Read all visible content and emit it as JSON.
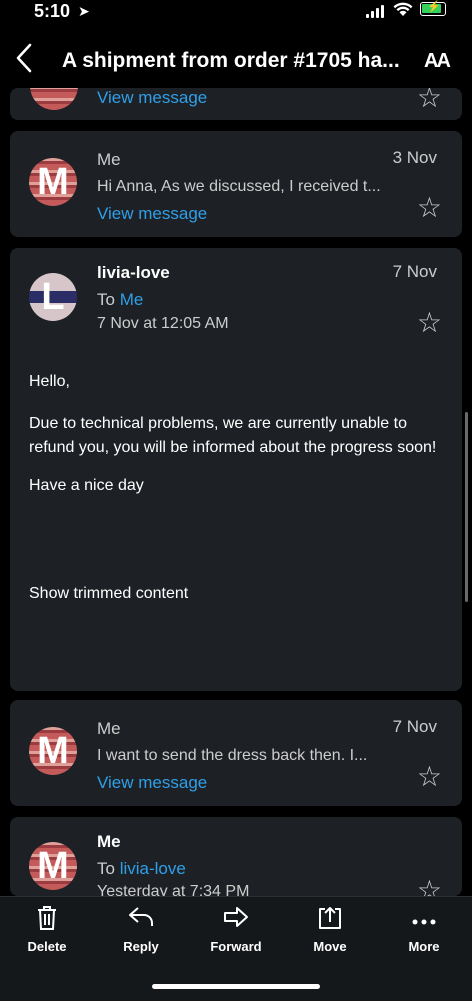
{
  "status": {
    "time": "5:10"
  },
  "nav": {
    "title": "A shipment from order #1705 ha...",
    "text_size_icon": "AA"
  },
  "top_card": {
    "link": "View message"
  },
  "message2": {
    "sender": "Me",
    "date": "3 Nov",
    "preview": "Hi Anna, As we discussed, I received t...",
    "link": "View message",
    "avatar_letter": "M"
  },
  "message3": {
    "sender": "livia-love",
    "date": "7 Nov",
    "to_label": "To",
    "to_name": "Me",
    "sent": "7 Nov at 12:05 AM",
    "avatar_letter": "L",
    "body": {
      "greeting": "Hello,",
      "paragraph": "Due to technical problems, we are currently unable to refund you, you will be informed about the progress soon!",
      "closing": "Have a nice day",
      "trimmed": "Show trimmed content"
    }
  },
  "message4": {
    "sender": "Me",
    "date": "7 Nov",
    "preview": "I want to send the dress back then. I...",
    "link": "View message",
    "avatar_letter": "M"
  },
  "message5": {
    "sender": "Me",
    "to_label": "To",
    "to_name": "livia-love",
    "sent": "Yesterday at 7:34 PM",
    "avatar_letter": "M"
  },
  "toolbar": {
    "delete": "Delete",
    "reply": "Reply",
    "forward": "Forward",
    "move": "Move",
    "more": "More"
  },
  "icons": [
    "location-arrow-icon",
    "signal-icon",
    "wifi-icon",
    "battery-icon",
    "back-icon",
    "text-size-icon",
    "star-icon",
    "delete-icon",
    "reply-icon",
    "forward-icon",
    "move-icon",
    "more-icon"
  ],
  "colors": {
    "background": "#000000",
    "card": "#1d2126",
    "link": "#2f9fe8",
    "battery": "#35d05b"
  }
}
